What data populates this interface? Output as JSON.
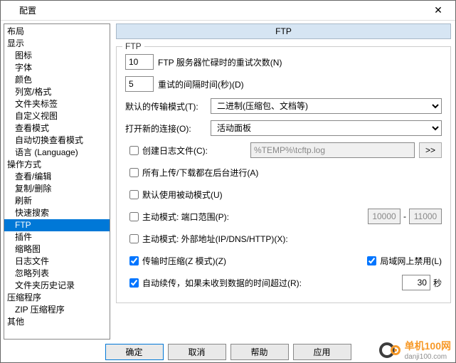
{
  "titlebar": {
    "title": "配置",
    "close": "✕"
  },
  "tree": [
    {
      "label": "布局",
      "ind": 0
    },
    {
      "label": "显示",
      "ind": 0
    },
    {
      "label": "图标",
      "ind": 1
    },
    {
      "label": "字体",
      "ind": 1
    },
    {
      "label": "颜色",
      "ind": 1
    },
    {
      "label": "列宽/格式",
      "ind": 1
    },
    {
      "label": "文件夹标签",
      "ind": 1
    },
    {
      "label": "自定义视图",
      "ind": 1
    },
    {
      "label": "查看模式",
      "ind": 1
    },
    {
      "label": "自动切换查看模式",
      "ind": 1
    },
    {
      "label": "语言 (Language)",
      "ind": 1
    },
    {
      "label": "操作方式",
      "ind": 0
    },
    {
      "label": "查看/编辑",
      "ind": 1
    },
    {
      "label": "复制/删除",
      "ind": 1
    },
    {
      "label": "刷新",
      "ind": 1
    },
    {
      "label": "快速搜索",
      "ind": 1
    },
    {
      "label": "FTP",
      "ind": 1,
      "sel": true
    },
    {
      "label": "插件",
      "ind": 1
    },
    {
      "label": "缩略图",
      "ind": 1
    },
    {
      "label": "日志文件",
      "ind": 1
    },
    {
      "label": "忽略列表",
      "ind": 1
    },
    {
      "label": "文件夹历史记录",
      "ind": 1
    },
    {
      "label": "压缩程序",
      "ind": 0
    },
    {
      "label": "ZIP 压缩程序",
      "ind": 1
    },
    {
      "label": "其他",
      "ind": 0
    }
  ],
  "main": {
    "header": "FTP",
    "group_title": "FTP",
    "retry_count": "10",
    "retry_count_label": "FTP 服务器忙碌时的重试次数(N)",
    "retry_delay": "5",
    "retry_delay_label": "重试的间隔时间(秒)(D)",
    "transfer_mode_label": "默认的传输模式(T):",
    "transfer_mode_value": "二进制(压缩包、文档等)",
    "open_new_label": "打开新的连接(O):",
    "open_new_value": "活动面板",
    "create_log_label": "创建日志文件(C):",
    "log_path": "%TEMP%\\tcftp.log",
    "log_btn": ">>",
    "background_label": "所有上传/下载都在后台进行(A)",
    "passive_label": "默认使用被动模式(U)",
    "active_range_label": "主动模式: 端口范围(P):",
    "port_from": "10000",
    "port_sep": "-",
    "port_to": "11000",
    "active_ext_label": "主动模式: 外部地址(IP/DNS/HTTP)(X):",
    "compress_label": "传输时压缩(Z 模式)(Z)",
    "lan_disable_label": "局域网上禁用(L)",
    "resume_label": "自动续传，如果未收到数据的时间超过(R):",
    "resume_value": "30",
    "resume_unit": "秒"
  },
  "footer": {
    "ok": "确定",
    "cancel": "取消",
    "help": "帮助",
    "apply": "应用"
  },
  "watermark": {
    "brand": "单机100网",
    "url": "danji100.com"
  }
}
